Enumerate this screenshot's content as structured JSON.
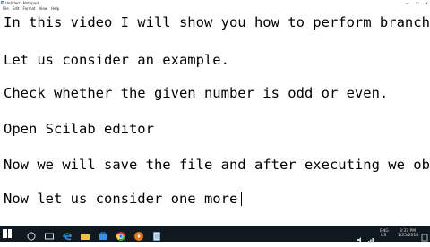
{
  "window": {
    "title": "Untitled - Notepad",
    "controls": [
      "—",
      "☐",
      "✕"
    ]
  },
  "menu": [
    "File",
    "Edit",
    "Format",
    "View",
    "Help"
  ],
  "editor": {
    "lines": [
      "In this video I will show you how to perform branch",
      "Let us consider an example.",
      "Check whether the given number is odd or even.",
      "Open Scilab editor",
      "Now we will save the file and after executing we ob",
      "Now let us consider one more"
    ]
  },
  "taskbar": {
    "tray_lang": "ENG",
    "tray_region": "US",
    "time": "8:37 PM",
    "date": "1/25/2018"
  },
  "colors": {
    "taskbar": "#101820",
    "text": "#000000"
  }
}
